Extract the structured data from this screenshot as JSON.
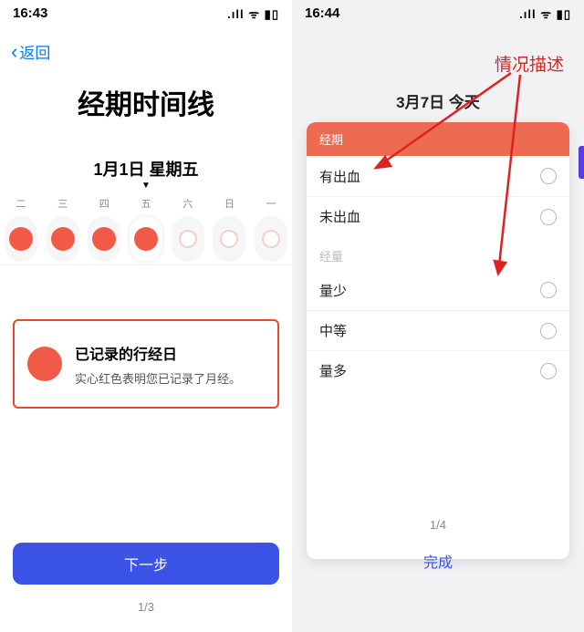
{
  "left": {
    "status_time": "16:43",
    "status_icons": ".ıll ᯤ ▮▯",
    "back_label": "返回",
    "title": "经期时间线",
    "date_header": "1月1日 星期五",
    "days": [
      {
        "label": "二",
        "logged": true,
        "active": false
      },
      {
        "label": "三",
        "logged": true,
        "active": false
      },
      {
        "label": "四",
        "logged": true,
        "active": false
      },
      {
        "label": "五",
        "logged": true,
        "active": true
      },
      {
        "label": "六",
        "logged": false,
        "active": false
      },
      {
        "label": "日",
        "logged": false,
        "active": false
      },
      {
        "label": "一",
        "logged": false,
        "active": false
      }
    ],
    "info_title": "已记录的行经日",
    "info_desc": "实心红色表明您已记录了月经。",
    "next_label": "下一步",
    "pager": "1/3"
  },
  "right": {
    "status_time": "16:44",
    "status_icons": ".ıll ᯤ ▮▯",
    "annotation": "情况描述",
    "date_header": "3月7日 今天",
    "section1_title": "经期",
    "section1_items": [
      "有出血",
      "未出血"
    ],
    "section2_title": "经量",
    "section2_items": [
      "量少",
      "中等",
      "量多"
    ],
    "done_label": "完成",
    "pager": "1/4"
  }
}
